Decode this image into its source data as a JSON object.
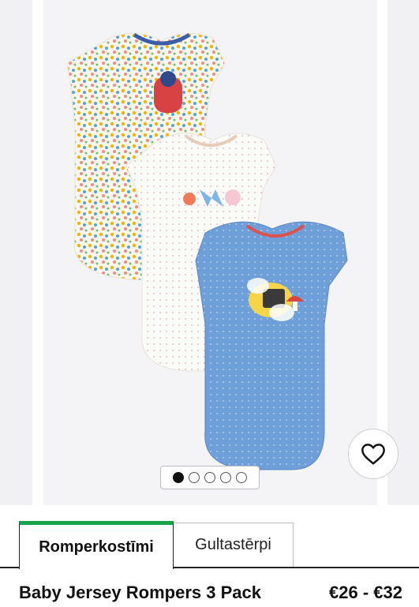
{
  "gallery": {
    "image_alt_icon": "baby-rompers-product-photo",
    "active_slide": 1,
    "slide_count": 5,
    "wishlist_icon": "heart-outline-icon"
  },
  "tabs": [
    {
      "label": "Romperkostīmi",
      "active": true
    },
    {
      "label": "Gultastērpi",
      "active": false
    }
  ],
  "product": {
    "title": "Baby Jersey Rompers 3 Pack",
    "price": "€26 - €32"
  },
  "colors": {
    "active_tab_accent": "#16a34a",
    "background": "#ffffff",
    "image_background": "#f4f4f6"
  }
}
